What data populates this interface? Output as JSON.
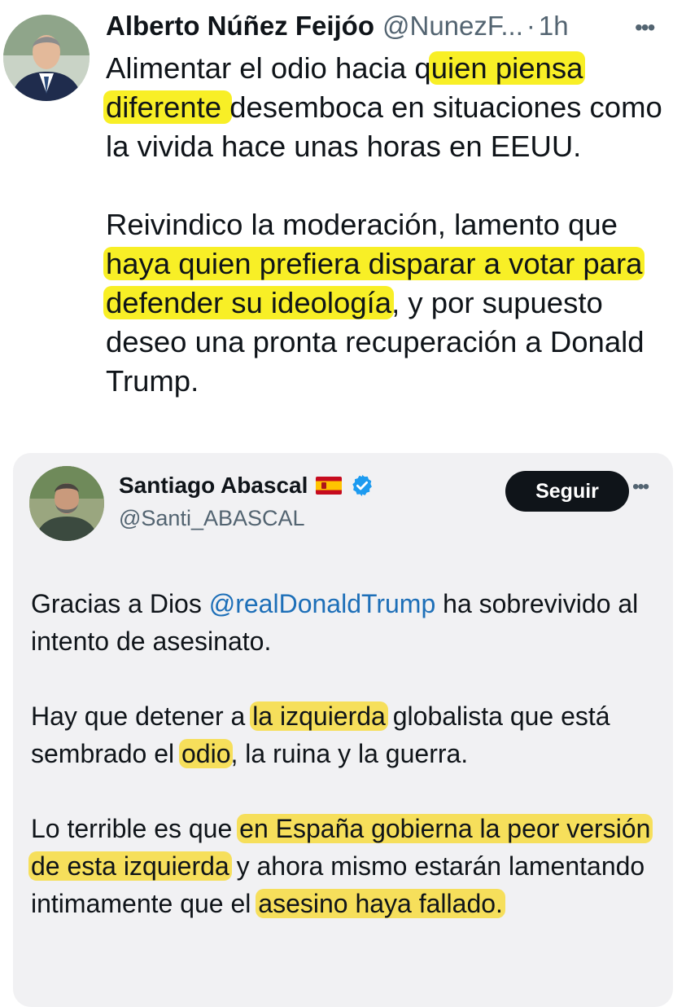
{
  "tweet1": {
    "author_name": "Alberto Núñez Feijóo",
    "handle": "@NunezF...",
    "separator": "·",
    "time": "1h",
    "more_icon": "more-horizontal-icon",
    "p1_part1": "Alimentar el odio hacia q",
    "p1_hl1": "uien piensa diferente ",
    "p1_part2": "desemboca en situaciones como la vivida hace unas horas en EEUU.",
    "p2_part1": "Reivindico la moderación, lamento que ",
    "p2_hl1": "haya quien prefiera disparar a votar para defender su ideología",
    "p2_part2": ", y por supuesto deseo una pronta recuperación a Donald Trump."
  },
  "tweet2": {
    "author_name": "Santiago Abascal",
    "handle": "@Santi_ABASCAL",
    "follow_label": "Seguir",
    "more_icon": "more-horizontal-icon",
    "verified_icon": "verified-badge-icon",
    "flag_icon": "spain-flag-icon",
    "p1_part1": "Gracias a Dios ",
    "p1_mention": "@realDonaldTrump",
    "p1_part2": " ha sobrevivido al intento de asesinato.",
    "p2_part1": "Hay que detener a ",
    "p2_hl1": "la izquierda",
    "p2_part2": " globalista que está sembrado el ",
    "p2_hl2": "odio",
    "p2_part3": ", la ruina y la guerra.",
    "p3_part1": "Lo terrible es que ",
    "p3_hl1": "en España gobierna la peor versión de esta izquierda",
    "p3_part2": " y ahora mismo estarán lamentando intimamente que el ",
    "p3_hl2": "asesino haya fallado."
  },
  "colors": {
    "highlight": "#f7ee14",
    "highlight_soft": "#f6dc46",
    "mention": "#1d6fb8",
    "card_bg": "#f1f1f3"
  }
}
